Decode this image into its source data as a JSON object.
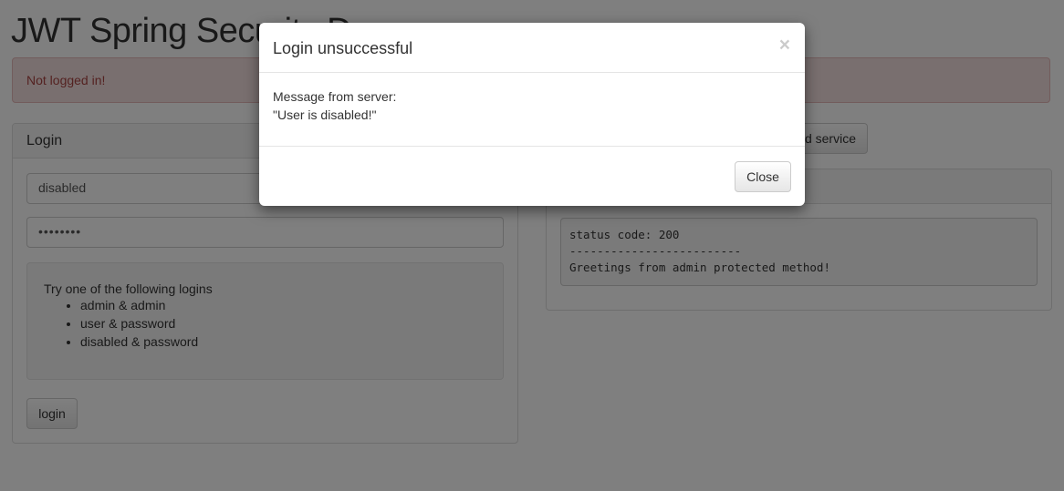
{
  "page": {
    "title": "JWT Spring Security Demo",
    "alert": "Not logged in!"
  },
  "login": {
    "heading": "Login",
    "username_value": "disabled",
    "password_value": "••••••••",
    "hint_title": "Try one of the following logins",
    "hints": [
      "admin & admin",
      "user & password",
      "disabled & password"
    ],
    "button_label": "login"
  },
  "service": {
    "button_label": "d service"
  },
  "response": {
    "line1": "status code: 200",
    "line2": "-------------------------",
    "line3": "Greetings from admin protected method!"
  },
  "modal": {
    "title": "Login unsuccessful",
    "close_symbol": "×",
    "message_label": "Message from server:",
    "message": "\"User is disabled!\"",
    "close_label": "Close"
  },
  "colors": {
    "alert_bg": "#f2dede",
    "alert_text": "#a94442",
    "backdrop": "rgba(0,0,0,0.5)"
  }
}
